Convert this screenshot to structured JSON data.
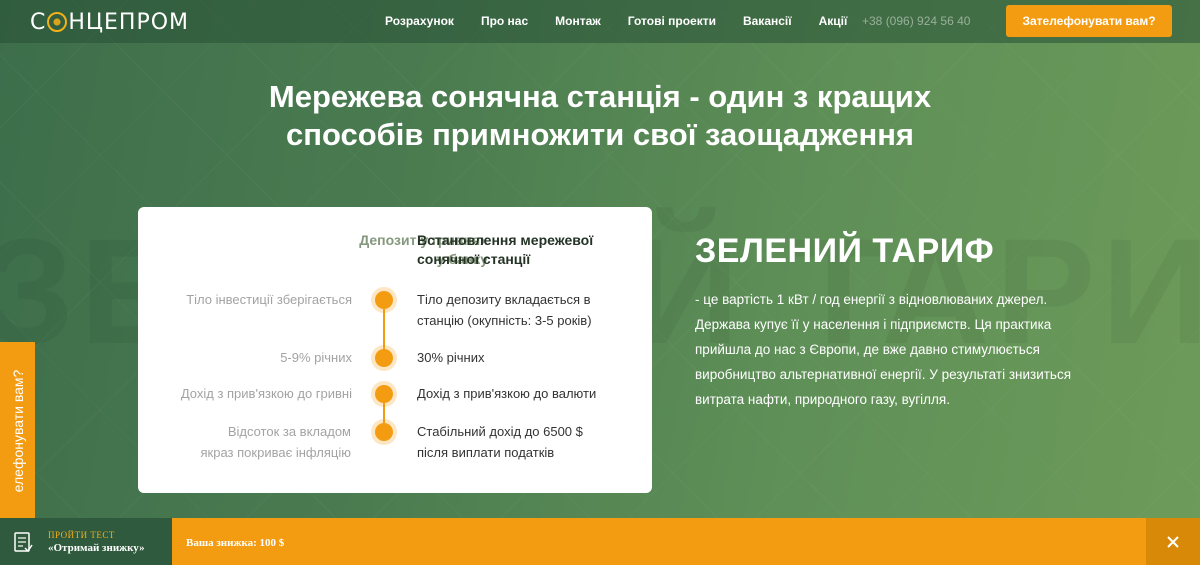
{
  "header": {
    "logo_text_before": "С",
    "logo_text_after": "НЦЕПРОМ",
    "nav": [
      {
        "label": "Розрахунок"
      },
      {
        "label": "Про нас"
      },
      {
        "label": "Монтаж"
      },
      {
        "label": "Готові проекти"
      },
      {
        "label": "Вакансії"
      },
      {
        "label": "Акції"
      }
    ],
    "phone": "+38 (096) 924 56 40",
    "call_button": "Зателефонувати вам?"
  },
  "hero": {
    "title_line1": "Мережева сонячна станція - один з кращих",
    "title_line2": "способів примножити свої заощадження"
  },
  "comparison": {
    "left_title": "Депозит у гривнях у банку",
    "right_title": "Встановлення мережевої сонячної станції",
    "rows": [
      {
        "left": "Тіло інвестиції зберігається",
        "right": "Тіло депозиту вкладається в станцію (окупність: 3-5 років)"
      },
      {
        "left": "5-9% річних",
        "right": "30% річних"
      },
      {
        "left": "Дохід з прив'язкою до гривні",
        "right": "Дохід з прив'язкою до валюти"
      },
      {
        "left": "Відсоток за вкладом якраз покриває інфляцію",
        "right": "Стабільний дохід до 6500 $ після виплати податків"
      }
    ]
  },
  "tariff": {
    "watermark": "ЗЕЛЕНИЙ ТАРИФ",
    "title": "ЗЕЛЕНИЙ ТАРИФ",
    "text": "- це вартість 1 кВт / год енергії з відновлюваних джерел. Держава купує її у населення і підприємств. Ця практика прийшла до нас з Європи, де вже давно стимулюється виробництво альтернативної енергії. У результаті знизиться витрата нафти, природного газу, вугілля."
  },
  "side_tab": {
    "label": "елефонувати вам?"
  },
  "bottom_bar": {
    "test_label": "ПРОЙТИ ТЕСТ",
    "test_cta": "«Отримай знижку»",
    "discount": "Ваша знижка: 100 $"
  },
  "colors": {
    "accent": "#f39c12",
    "dark_green": "#2f5a3d",
    "card_bg": "#ffffff"
  },
  "icons": [
    "logo-sun-icon",
    "checklist-icon",
    "close-icon"
  ]
}
